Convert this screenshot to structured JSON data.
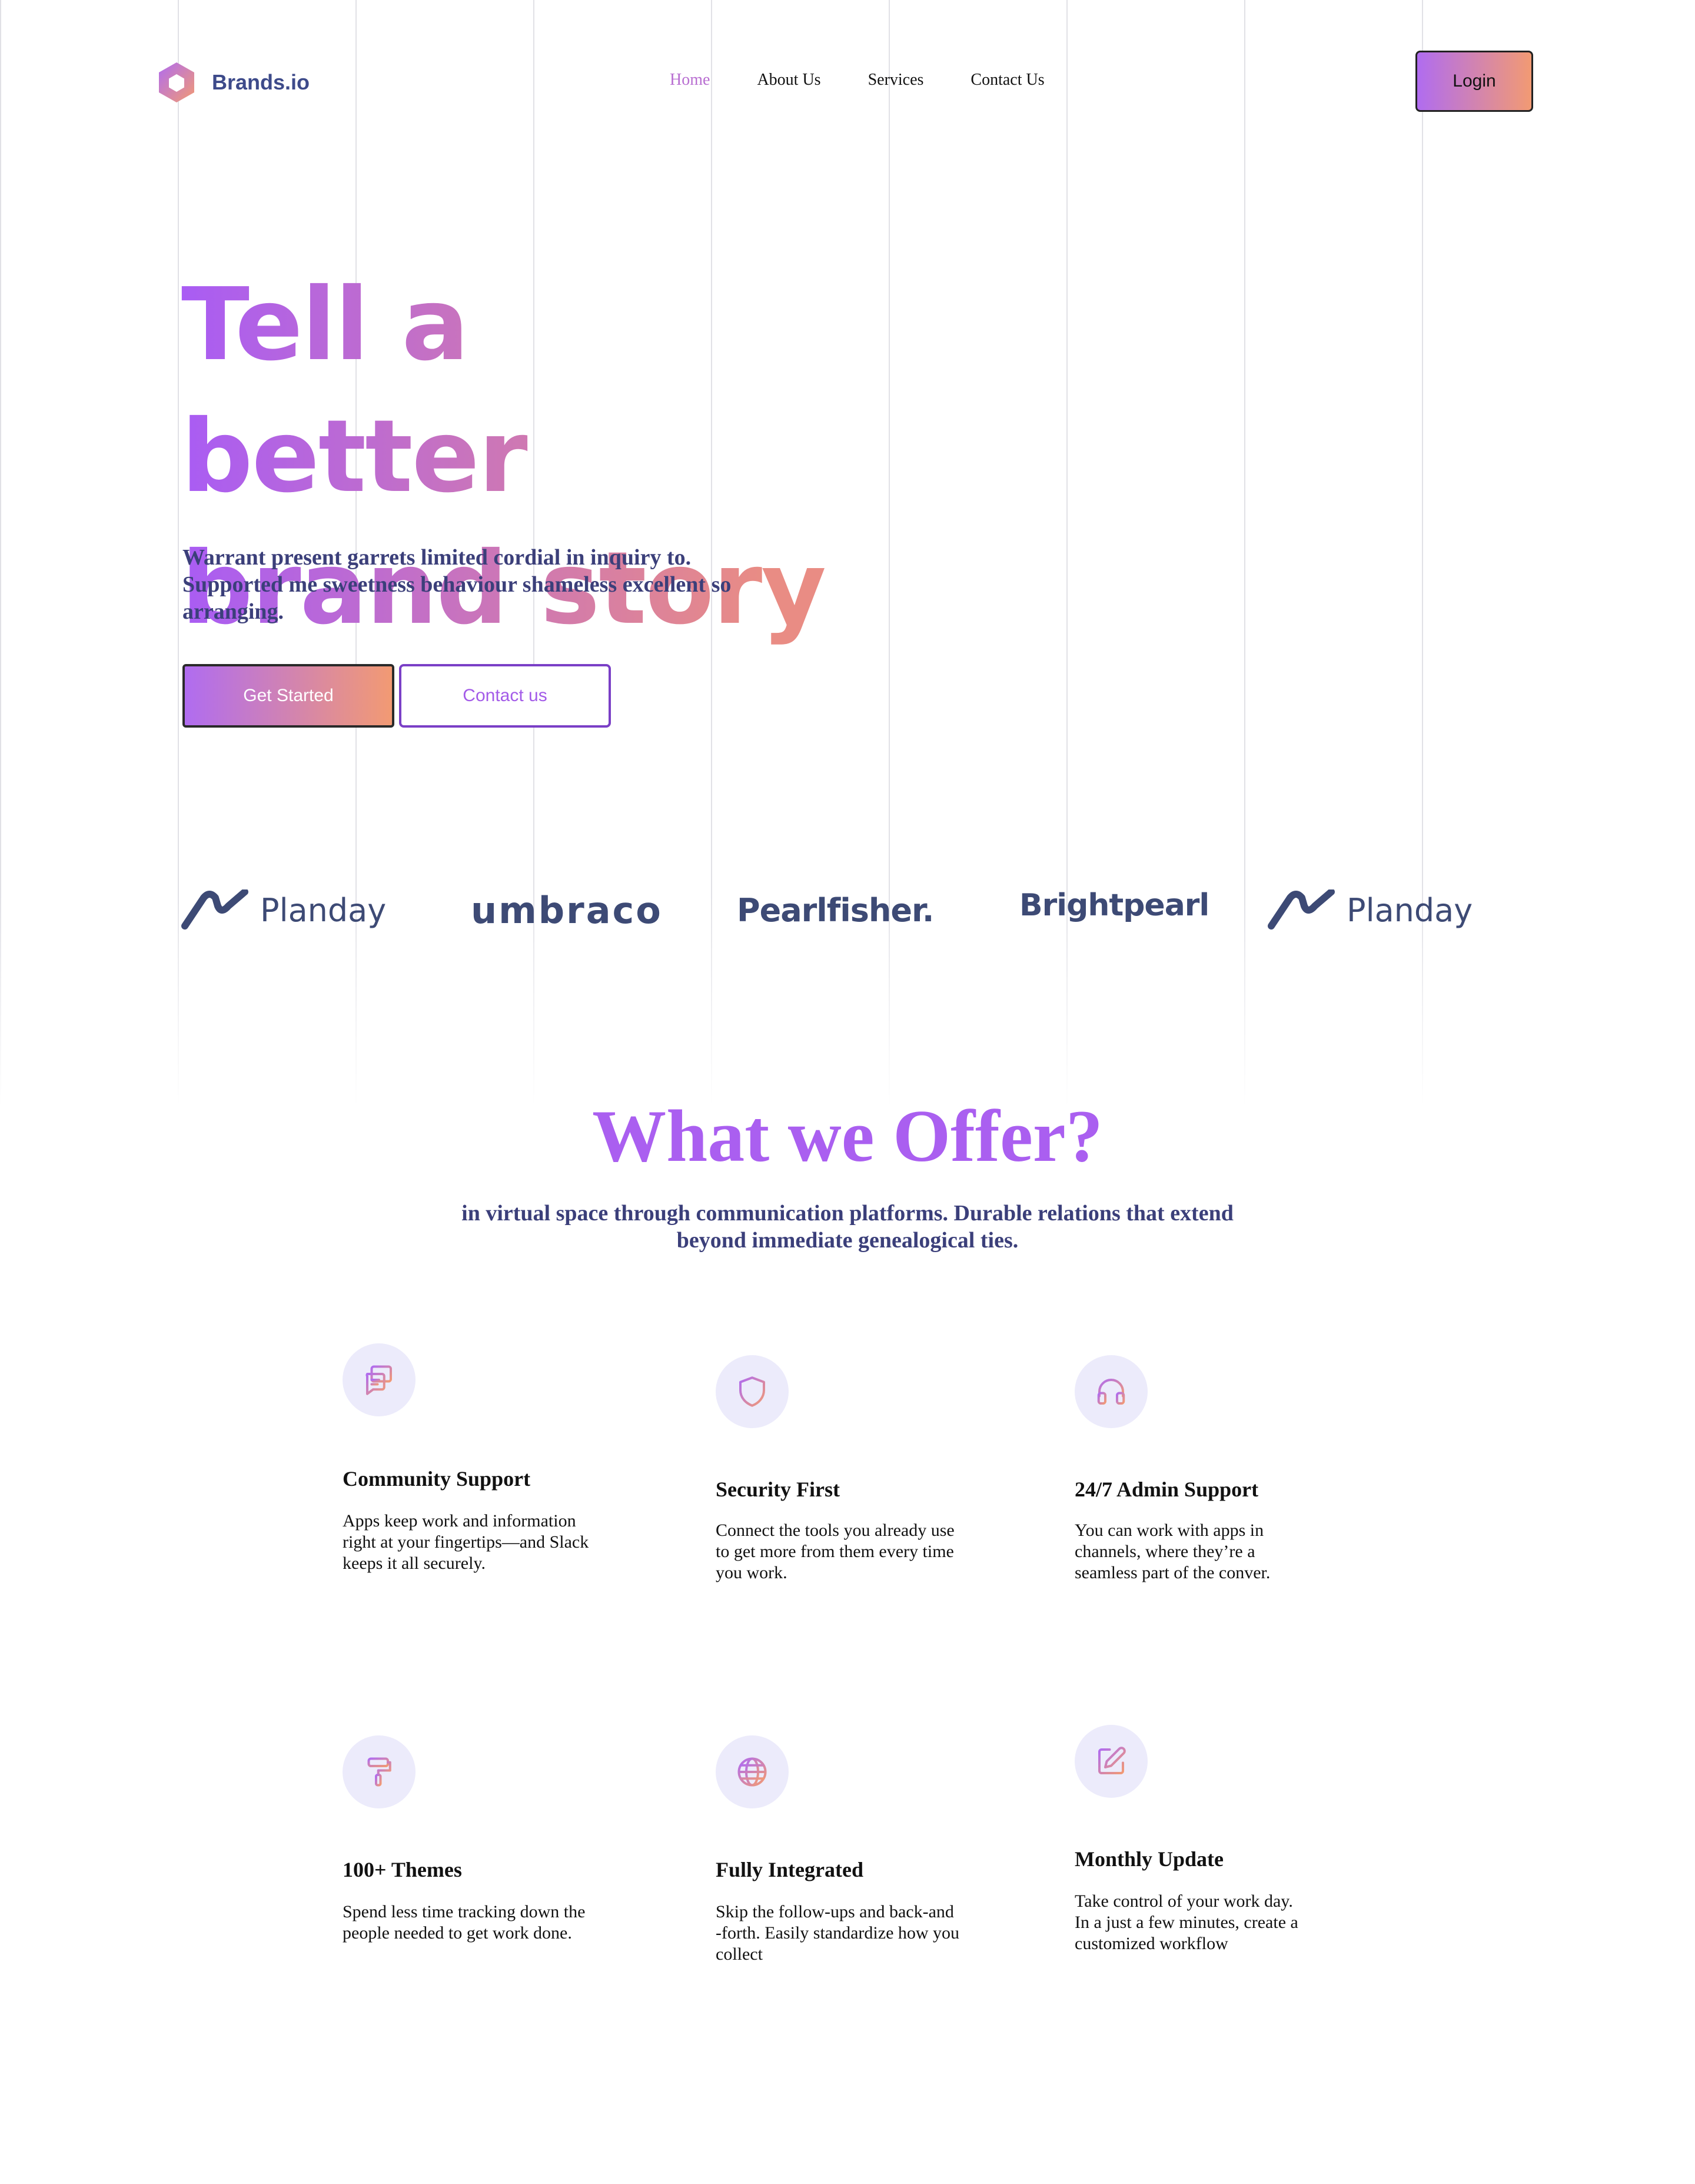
{
  "nav": {
    "brand": "Brands.io",
    "links": [
      "Home",
      "About Us",
      "Services",
      "Contact Us"
    ],
    "login": "Login"
  },
  "hero": {
    "title_line1": "Tell a better",
    "title_line2": "brand story",
    "subtitle": "Warrant present garrets limited cordial in inquiry to. Supported me sweetness behaviour shameless excellent so arranging.",
    "primary_button": "Get Started",
    "secondary_button": "Contact us"
  },
  "partners": [
    "Planday",
    "umbraco",
    "Pearlfisher.",
    "Brightpearl",
    "Planday"
  ],
  "offer": {
    "title": "What we Offer?",
    "subtitle": "in virtual space through communication platforms. Durable relations that extend beyond immediate genealogical ties.",
    "features": [
      {
        "icon": "chat-icon",
        "title": "Community Support",
        "text": "Apps keep work and information right at your fingertips—and Slack keeps it all securely."
      },
      {
        "icon": "shield-icon",
        "title": "Security First",
        "text": "Connect the tools you already use to get more from them every time you work."
      },
      {
        "icon": "headphones-icon",
        "title": "24/7 Admin Support",
        "text": "You can work with apps in channels, where they’re a seamless part of the conver."
      },
      {
        "icon": "paint-roller-icon",
        "title": "100+ Themes",
        "text": "Spend less time tracking down the people needed to get work done."
      },
      {
        "icon": "globe-icon",
        "title": "Fully Integrated",
        "text": "Skip the follow-ups and back-and -forth. Easily standardize how you collect"
      },
      {
        "icon": "edit-icon",
        "title": "Monthly Update",
        "text": "Take control of your work day. In a just a few minutes, create a customized workflow"
      }
    ]
  },
  "colors": {
    "gradient_start": "#b06cf0",
    "gradient_end": "#f29a73",
    "navy": "#3b3f7a",
    "accent": "#aa5ff0"
  }
}
